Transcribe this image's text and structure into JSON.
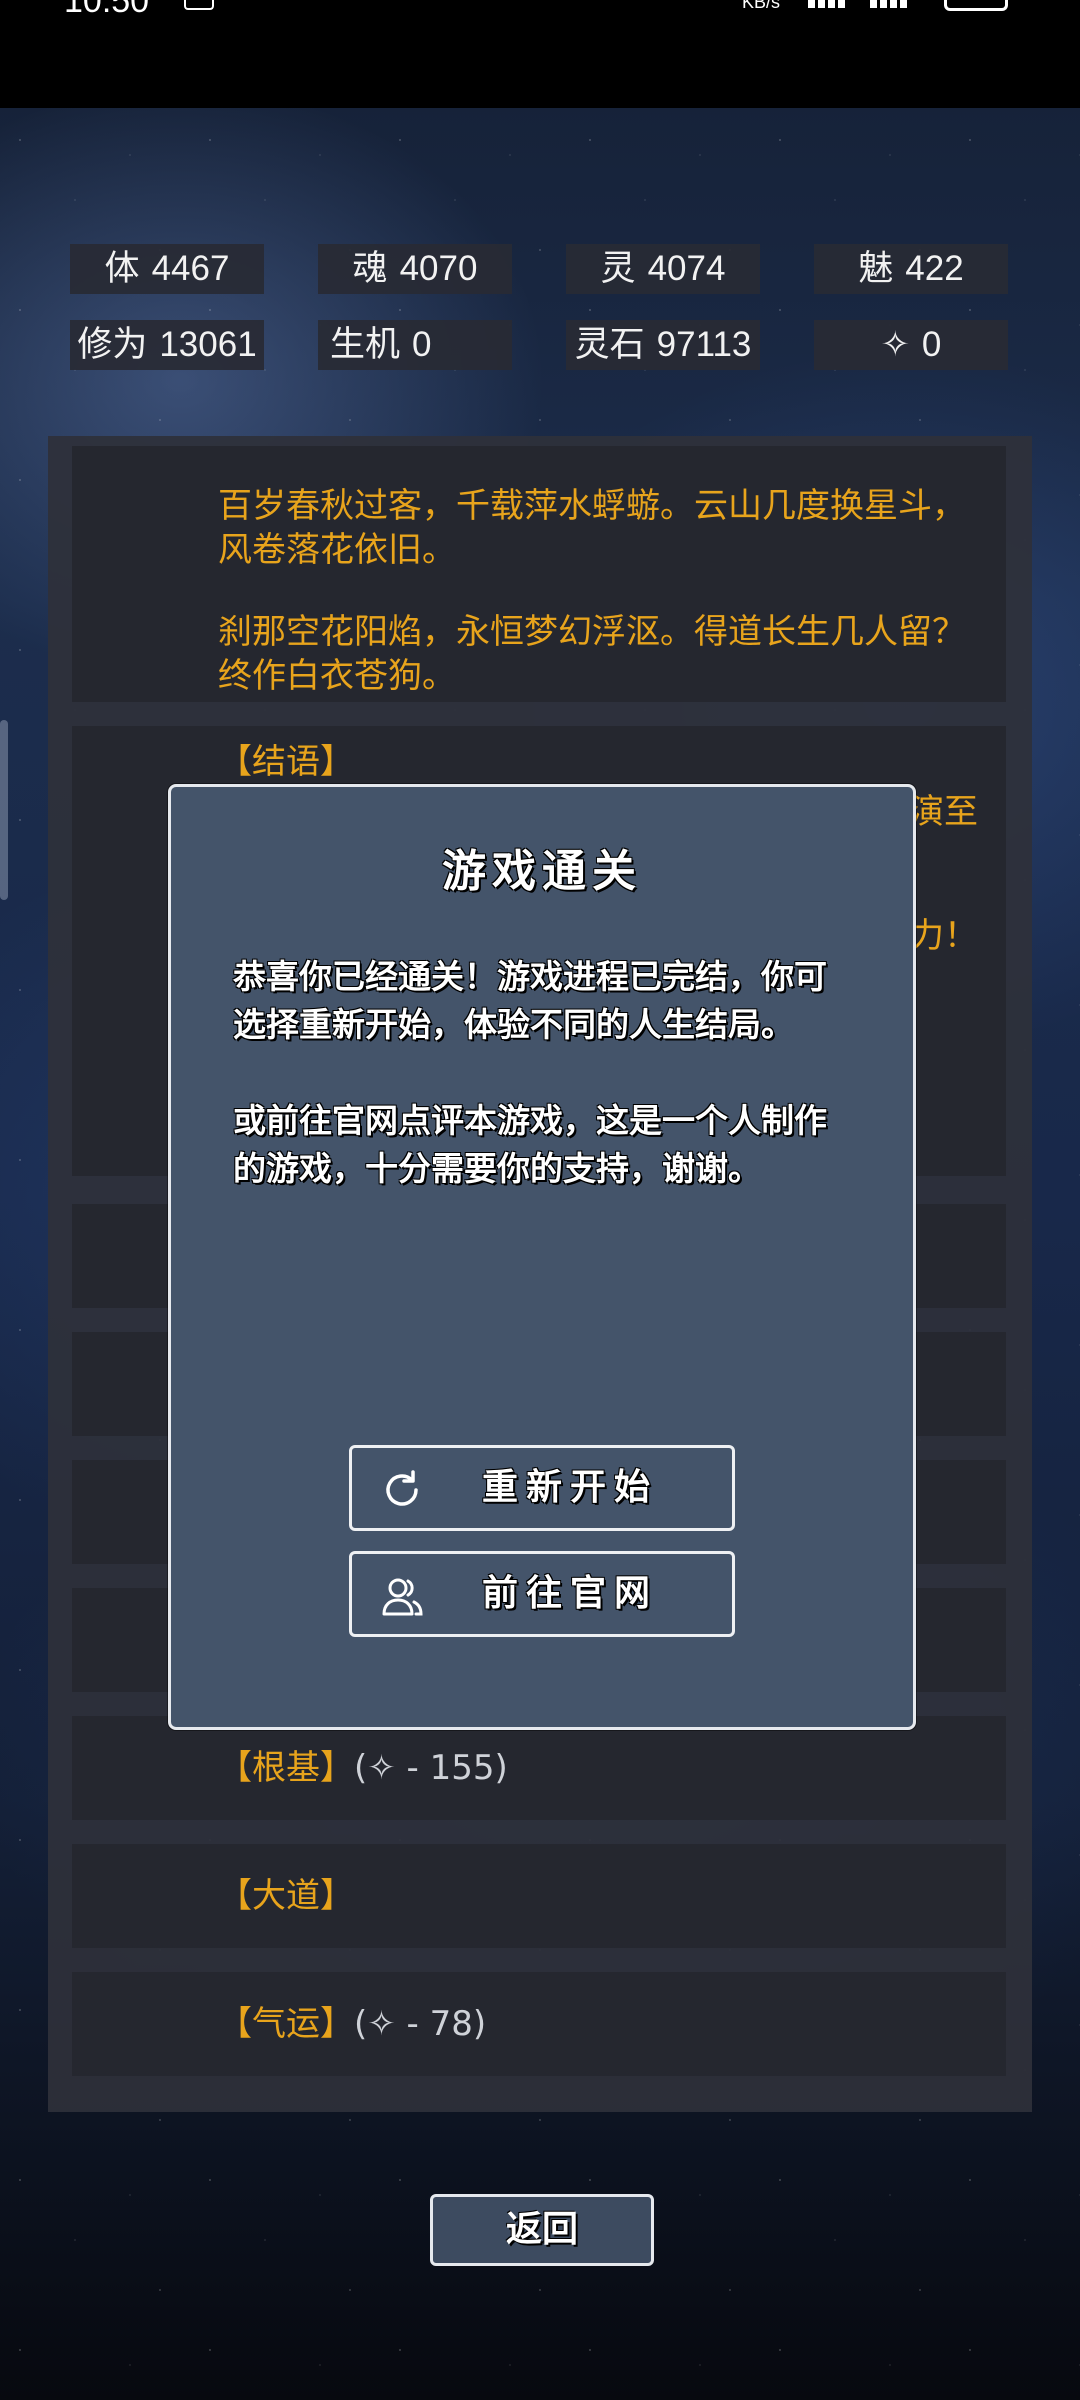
{
  "status_bar": {
    "time": "10:50",
    "net_speed": "KB/s",
    "icons": [
      "notification-icon",
      "signal-icon",
      "signal-icon",
      "battery-icon"
    ]
  },
  "stats": [
    {
      "key": "体",
      "value": "4467"
    },
    {
      "key": "魂",
      "value": "4070"
    },
    {
      "key": "灵",
      "value": "4074"
    },
    {
      "key": "魅",
      "value": "422"
    },
    {
      "key": "修为",
      "value": "13061"
    },
    {
      "key": "生机",
      "value": "0"
    },
    {
      "key": "灵石",
      "value": "97113"
    },
    {
      "key": "✧",
      "value": "0"
    }
  ],
  "poem": {
    "line1": "百岁春秋过客，千载萍水蜉蝣。云山几度换星斗，风卷落花依旧。",
    "line2": "刹那空花阳焰，永恒梦幻浮沤。得道长生几人留？终作白衣苍狗。"
  },
  "epilogue": {
    "heading": "【结语】",
    "frag1": "演至",
    "frag2": "力！"
  },
  "entries": [
    {
      "label": "【根基】",
      "extra": "(✧ - 155)"
    },
    {
      "label": "【大道】",
      "extra": ""
    },
    {
      "label": "【气运】",
      "extra": "(✧ - 78)"
    }
  ],
  "dialog": {
    "title": "游戏通关",
    "message": "恭喜你已经通关！游戏进程已完结，你可选择重新开始，体验不同的人生结局。\n\n或前往官网点评本游戏，这是一个人制作的游戏，十分需要你的支持，谢谢。",
    "restart_label": "重新开始",
    "website_label": "前往官网"
  },
  "back_label": "返回",
  "colors": {
    "accent_gold": "#e8a41c",
    "dialog_bg": "#44546a"
  }
}
